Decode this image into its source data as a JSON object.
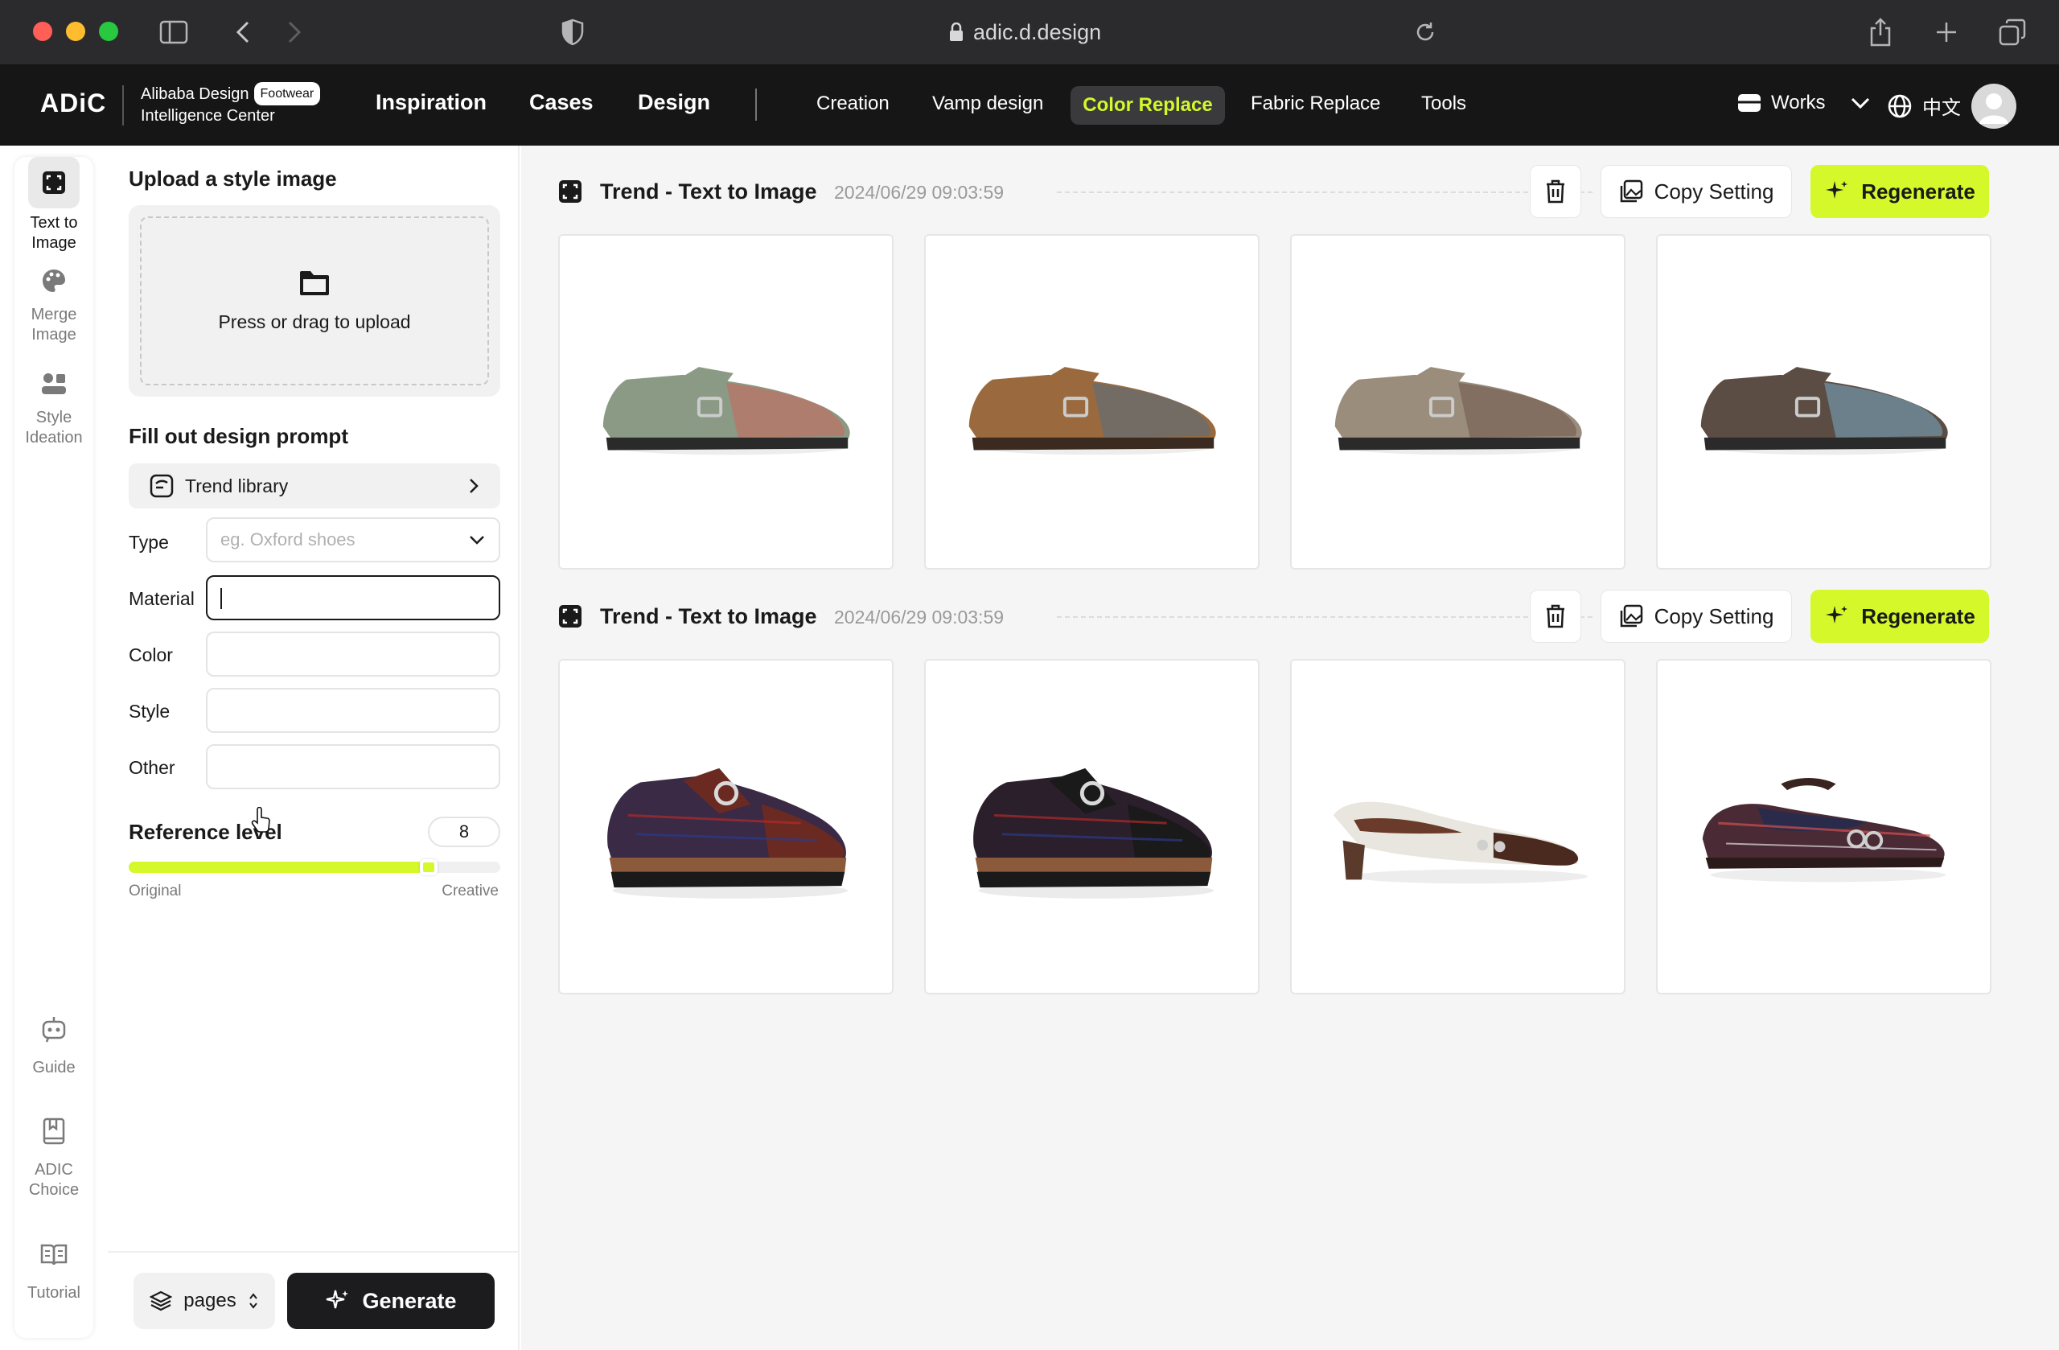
{
  "browser": {
    "url": "adic.d.design"
  },
  "header": {
    "logo": "ADiC",
    "brand_line1": "Alibaba Design",
    "brand_badge": "Footwear",
    "brand_line2": "Intelligence Center",
    "main_nav": [
      "Inspiration",
      "Cases",
      "Design"
    ],
    "sub_nav": [
      "Creation",
      "Vamp design",
      "Color Replace",
      "Fabric Replace",
      "Tools"
    ],
    "active_sub_nav": "Color Replace",
    "works_label": "Works",
    "language_label": "中文"
  },
  "rail": {
    "top_items": [
      {
        "label_1": "Text to",
        "label_2": "Image",
        "icon": "frame-icon",
        "active": true
      },
      {
        "label_1": "Merge",
        "label_2": "Image",
        "icon": "palette-icon",
        "active": false
      },
      {
        "label_1": "Style",
        "label_2": "Ideation",
        "icon": "people-icon",
        "active": false
      }
    ],
    "bottom_items": [
      {
        "label_1": "Guide",
        "label_2": "",
        "icon": "robot-icon"
      },
      {
        "label_1": "ADIC",
        "label_2": "Choice",
        "icon": "bookmark-icon"
      },
      {
        "label_1": "Tutorial",
        "label_2": "",
        "icon": "book-icon"
      }
    ]
  },
  "panel": {
    "upload_heading": "Upload a style image",
    "upload_hint": "Press or drag to upload",
    "prompt_heading": "Fill out design prompt",
    "trend_library": "Trend library",
    "fields": {
      "type": {
        "label": "Type",
        "placeholder": "eg. Oxford shoes"
      },
      "material": {
        "label": "Material",
        "value": ""
      },
      "color": {
        "label": "Color",
        "value": ""
      },
      "style": {
        "label": "Style",
        "value": ""
      },
      "other": {
        "label": "Other",
        "value": ""
      }
    },
    "reference": {
      "heading": "Reference level",
      "value": "8",
      "level_fraction": 0.8,
      "min_label": "Original",
      "max_label": "Creative"
    },
    "pages_label": "pages",
    "generate_label": "Generate"
  },
  "results": {
    "groups": [
      {
        "title": "Trend - Text to Image",
        "date": "2024/06/29 09:03:59",
        "copy_label": "Copy Setting",
        "regen_label": "Regenerate",
        "images": [
          {
            "name": "sage monk strap with plaid",
            "upper": "#8a9a84",
            "accent": "#b5786a",
            "sole": "#2a2a2a",
            "style": "flat"
          },
          {
            "name": "tan derby with grey heel",
            "upper": "#9a6a3e",
            "accent": "#6c6c6c",
            "sole": "#3b2a20",
            "style": "flat"
          },
          {
            "name": "taupe monk strap plaid",
            "upper": "#9a8d7c",
            "accent": "#7f6a5e",
            "sole": "#2a2a2a",
            "style": "flat"
          },
          {
            "name": "brown derby plaid toe",
            "upper": "#5b4d43",
            "accent": "#6e8a96",
            "sole": "#2a2a2a",
            "style": "flat"
          }
        ]
      },
      {
        "title": "Trend - Text to Image",
        "date": "2024/06/29 09:03:59",
        "copy_label": "Copy Setting",
        "regen_label": "Regenerate",
        "images": [
          {
            "name": "tartan monk lug sole",
            "upper": "#3a2a45",
            "accent": "#6a2a22",
            "sole": "#1a1a1a",
            "style": "lug"
          },
          {
            "name": "black tartan monk lug sole",
            "upper": "#2a1f2a",
            "accent": "#1a1a1a",
            "sole": "#1a1a1a",
            "style": "lug"
          },
          {
            "name": "white pump with brown toe",
            "upper": "#e9e6df",
            "accent": "#4a2a1f",
            "sole": "#5a3a2a",
            "style": "heel"
          },
          {
            "name": "tartan mary jane",
            "upper": "#4a2a35",
            "accent": "#2a2b4a",
            "sole": "#2a1a1a",
            "style": "maryjane"
          }
        ]
      }
    ]
  }
}
